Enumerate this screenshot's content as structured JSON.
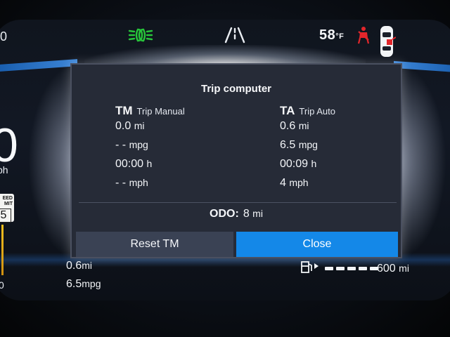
{
  "status_bar": {
    "left_partial": "0",
    "temperature": "58",
    "temperature_unit": "°F",
    "icons": [
      "headlight-icon",
      "lane-assist-icon",
      "seatbelt-warning-icon",
      "car-door-icon"
    ],
    "colors": {
      "headlight": "#27c43a",
      "seatbelt": "#e3262b"
    }
  },
  "left_gauge": {
    "speed_partial": "0",
    "unit_partial": "ph",
    "speed_limit_top": "EED\nMIT",
    "speed_limit_value": "5",
    "bottom_partial": "0"
  },
  "bottom": {
    "distance_value": "0.6",
    "distance_unit": "mi",
    "economy_value": "6.5",
    "economy_unit": "mpg",
    "range_value": "600",
    "range_unit": "mi"
  },
  "dialog": {
    "title": "Trip computer",
    "trip_manual": {
      "abbr": "TM",
      "caption": "Trip Manual",
      "distance": "0.0",
      "distance_unit": "mi",
      "economy": "- -",
      "economy_unit": "mpg",
      "time": "00:00",
      "time_unit": "h",
      "speed": "- -",
      "speed_unit": "mph"
    },
    "trip_auto": {
      "abbr": "TA",
      "caption": "Trip Auto",
      "distance": "0.6",
      "distance_unit": "mi",
      "economy": "6.5",
      "economy_unit": "mpg",
      "time": "00:09",
      "time_unit": "h",
      "speed": "4",
      "speed_unit": "mph"
    },
    "odo_label": "ODO:",
    "odo_value": "8",
    "odo_unit": "mi",
    "reset_label": "Reset TM",
    "close_label": "Close",
    "colors": {
      "close_button": "#1488e8",
      "reset_button": "#3a4254",
      "panel": "#262b37"
    }
  }
}
